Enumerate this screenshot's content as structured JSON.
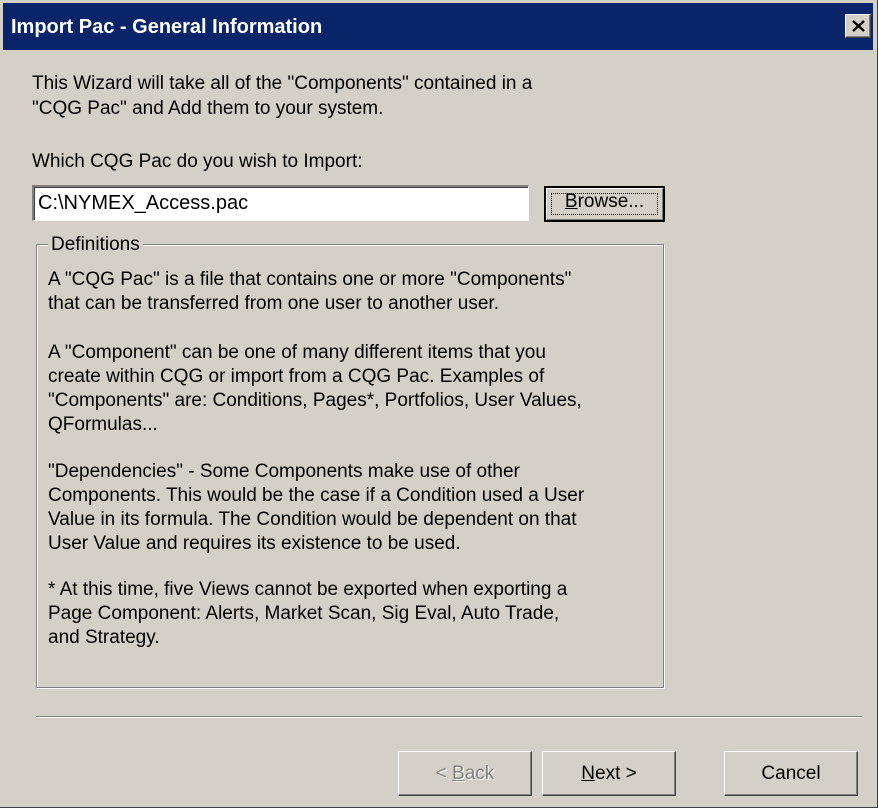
{
  "window": {
    "title": "Import Pac - General Information",
    "close_symbol": "×",
    "icon": "close-icon"
  },
  "intro": {
    "line1": "This Wizard will take all of the \"Components\" contained in a",
    "line2": "\"CQG Pac\" and Add them to your system."
  },
  "import": {
    "prompt": "Which CQG Pac do you wish to Import:",
    "path_value": "C:\\NYMEX_Access.pac",
    "browse_label_mnemonic": "B",
    "browse_label_rest": "rowse..."
  },
  "definitions": {
    "group_label": "Definitions",
    "paragraphs": [
      {
        "lines": [
          "A \"CQG Pac\" is a file that contains one or more \"Components\"",
          "that can be transferred from one user to another user."
        ]
      },
      {
        "lines": [
          "A \"Component\" can be one of many different items that you",
          "create within CQG or import from a CQG Pac.  Examples of",
          "\"Components\" are:  Conditions, Pages*, Portfolios, User Values,",
          "QFormulas..."
        ]
      },
      {
        "lines": [
          "\"Dependencies\" - Some Components make use of other",
          "Components. This would be the case if a Condition used a User",
          "Value in its formula. The Condition would be dependent on that",
          "User Value and requires its existence to be used."
        ]
      },
      {
        "lines": [
          "* At this time, five Views cannot be exported when exporting a",
          "Page Component: Alerts, Market Scan, Sig Eval, Auto Trade,",
          "and Strategy."
        ]
      }
    ]
  },
  "buttons": {
    "back_prefix": "< ",
    "back_mnemonic": "B",
    "back_rest": "ack",
    "next_mnemonic": "N",
    "next_rest": "ext >",
    "cancel": "Cancel"
  },
  "colors": {
    "titlebar": "#0a246a",
    "face": "#d4d0c8",
    "disabled_text": "#808080"
  }
}
